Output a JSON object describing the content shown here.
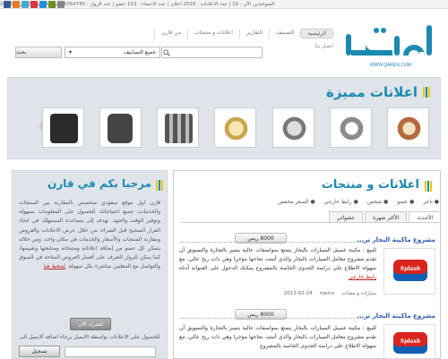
{
  "topbar": {
    "date": "الخميس 7 فبراير 2013",
    "visitors": "عدد الزوار : 1054745 زائر",
    "members": "عدد الاعضاء : 113 عضو",
    "ads": "عدد الاعلانات : 2029 اعلان",
    "online": "المتواجدين الآن : 16"
  },
  "social_colors": [
    "#3b5998",
    "#e57a1e",
    "#45a7d8",
    "#d8363a",
    "#1e90d3",
    "#6b8e23",
    "#888888"
  ],
  "logo": {
    "mark": "قارن",
    "url": "WWW.QAREN.COM",
    "color": "#1a8ab0"
  },
  "nav": {
    "items": [
      "الرئيسية",
      "التصنيف",
      "التقارير",
      "اعلانات و منتجات",
      "من قارن"
    ],
    "sub": "اتصل بنا"
  },
  "search": {
    "select_value": "جميع التصانيف",
    "button_label": "بحث"
  },
  "featured": {
    "title": "اعلانات مميزة",
    "thumb_count": 7
  },
  "welcome": {
    "title": "مرحبا بكم في قارن",
    "body": "قارن اول موقع سعودي متخصص بالمقارنة بين المنتجات والخدمات، جميع احتياجاتك للحصول على المعلومات بسهولة وتوفير الوقت والجهد. نهدف إلى مساعدة المستهلك في اتخاذ القرار الصحيح قبل الشراء، من خلال عرض الاعلانات والعروض ومقارنة المنتجات والأسعار والخدمات في مكان واحد، ومن خلاله يتمكن كل عضو من إضافة اعلاناته ومنتجاته ومتابعتها وتقييمها، كما يمكن للزوار التعرف على أفضل العروض المتاحة في السوق والتواصل مع المعلنين مباشرة بكل سهولة.",
    "link": "إضغط هنا",
    "join_button": "اشترك الان",
    "email_label": "للحصول على الاعلانات بواسطة الايميل يرجاء اضافة الايميل الى",
    "register_button": "تسجيل"
  },
  "listings": {
    "title": "اعلانات و منتجات",
    "filters": [
      "تاجر",
      "عضو",
      "شخص",
      "رابط خارجي",
      "السعر مخفض"
    ],
    "tabs": [
      "الأحدث",
      "الأكثر شهرة",
      "عشوائي"
    ],
    "items": [
      {
        "title": "مشروع ماكينة النجار تر...",
        "price": "8000 ريس",
        "desc": "للبيع : مكينة غسيل السيارات بالبخار يتمتع بمواصفات عالية يتميز بالتجارة والتسويق أن تقدم مشروع معامل السيارات بالبخار والذي أثبتت نجاحها مؤخرا وهي ذات ربح عالي. مع سهولة الاطلاع على دراسة الجدوى الخاصة بالمشروع يمكنك الدخول على العنوانه أدناه",
        "ext_link": "رابط خارجي",
        "date": "2013-02-24",
        "user": "melco",
        "category": "سيارات و معدات",
        "logo_text": "Splash"
      },
      {
        "title": "مشروع ماكينة النجار تر...",
        "price": "8000 ريس",
        "desc": "للبيع : مكينة غسيل السيارات بالبخار يتمتع بمواصفات عالية يتميز بالتجارة والتسويق أن تقدم مشروع معامل السيارات بالبخار والذي أثبتت نجاحها مؤخرا وهي ذات ربح عالي. مع سهولة الاطلاع على دراسة الجدوى الخاصة بالمشروع",
        "logo_text": "Splash"
      }
    ]
  }
}
